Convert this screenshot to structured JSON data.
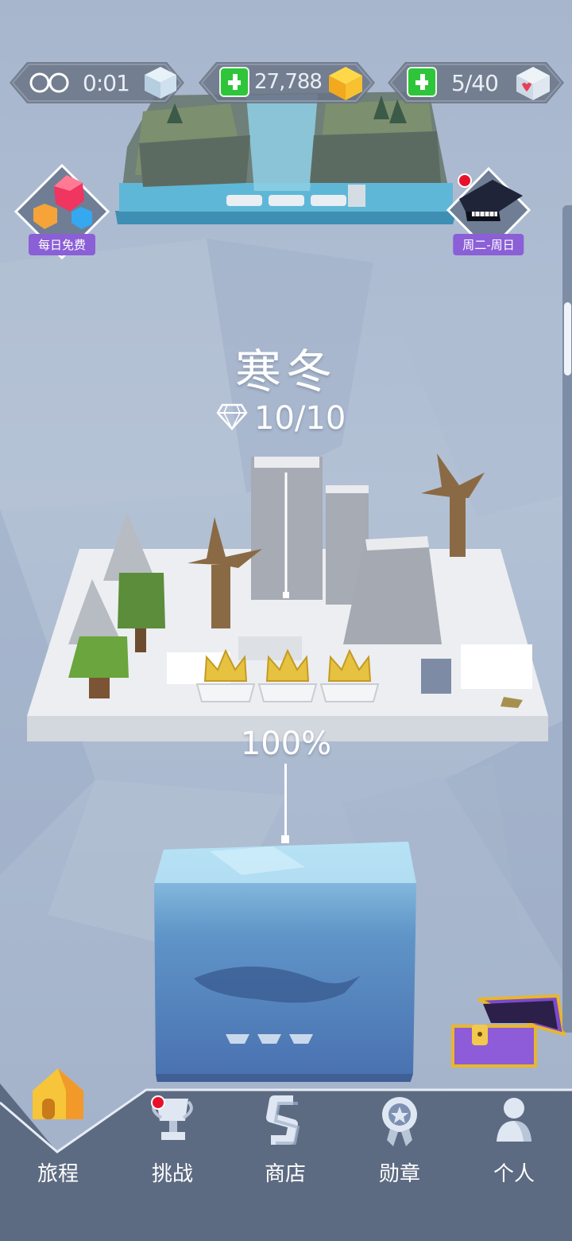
{
  "stats": {
    "timer": {
      "value": "0:01",
      "icon": "infinity-icon"
    },
    "coins": {
      "value": "27,788",
      "icon": "gold-cube-icon"
    },
    "lives": {
      "value": "5/40",
      "icon": "heart-cube-icon"
    }
  },
  "badges": {
    "daily_free": {
      "label": "每日免费",
      "icon": "gems-bundle-icon"
    },
    "weekly_event": {
      "label": "周二-周日",
      "icon": "grand-piano-icon"
    }
  },
  "level": {
    "title": "寒冬",
    "gems": "10/10",
    "progress": "100%",
    "progress_value": 100
  },
  "nav": {
    "items": [
      {
        "label": "旅程",
        "icon": "home-icon",
        "active": true
      },
      {
        "label": "挑战",
        "icon": "trophy-icon"
      },
      {
        "label": "商店",
        "icon": "shop-icon"
      },
      {
        "label": "勋章",
        "icon": "medal-icon"
      },
      {
        "label": "个人",
        "icon": "profile-icon"
      }
    ]
  },
  "colors": {
    "accent_green": "#2fc53a",
    "badge_purple": "#8b5fd6",
    "notification_red": "#e8112c",
    "nav_bg": "#5d6b82"
  }
}
